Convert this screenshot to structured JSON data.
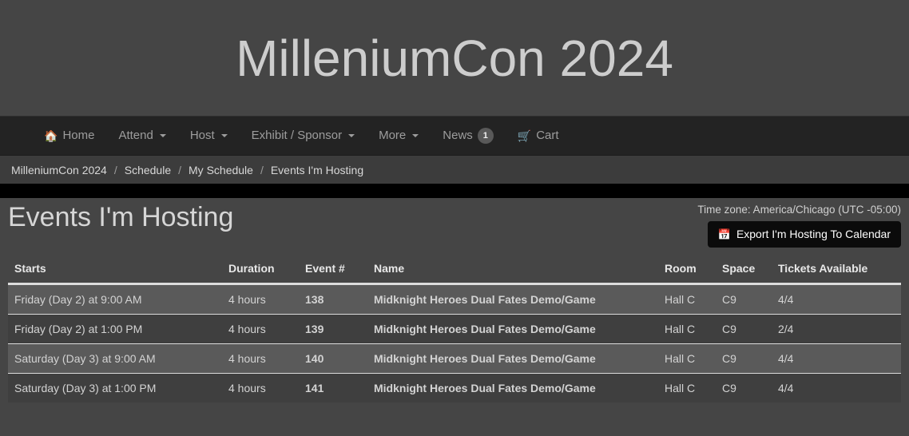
{
  "site": {
    "title": "MilleniumCon 2024"
  },
  "nav": {
    "items": [
      {
        "label": "Home",
        "icon": "home-icon",
        "caret": false,
        "badge": null
      },
      {
        "label": "Attend",
        "icon": null,
        "caret": true,
        "badge": null
      },
      {
        "label": "Host",
        "icon": null,
        "caret": true,
        "badge": null
      },
      {
        "label": "Exhibit / Sponsor",
        "icon": null,
        "caret": true,
        "badge": null
      },
      {
        "label": "More",
        "icon": null,
        "caret": true,
        "badge": null
      },
      {
        "label": "News",
        "icon": null,
        "caret": false,
        "badge": "1"
      },
      {
        "label": "Cart",
        "icon": "cart-icon",
        "caret": false,
        "badge": null
      }
    ]
  },
  "breadcrumb": {
    "separator": "/",
    "items": [
      {
        "label": "MilleniumCon 2024"
      },
      {
        "label": "Schedule"
      },
      {
        "label": "My Schedule"
      },
      {
        "label": "Events I'm Hosting"
      }
    ]
  },
  "page": {
    "title": "Events I'm Hosting",
    "timezone": "Time zone: America/Chicago (UTC -05:00)",
    "export_button": "Export I'm Hosting To Calendar",
    "export_icon": "calendar-icon"
  },
  "table": {
    "columns": [
      "Starts",
      "Duration",
      "Event #",
      "Name",
      "Room",
      "Space",
      "Tickets Available"
    ],
    "rows": [
      {
        "starts": "Friday (Day 2) at 9:00 AM",
        "duration": "4 hours",
        "event": "138",
        "name": "Midknight Heroes Dual Fates Demo/Game",
        "room": "Hall C",
        "space": "C9",
        "tickets": "4/4"
      },
      {
        "starts": "Friday (Day 2) at 1:00 PM",
        "duration": "4 hours",
        "event": "139",
        "name": "Midknight Heroes Dual Fates Demo/Game",
        "room": "Hall C",
        "space": "C9",
        "tickets": "2/4"
      },
      {
        "starts": "Saturday (Day 3) at 9:00 AM",
        "duration": "4 hours",
        "event": "140",
        "name": "Midknight Heroes Dual Fates Demo/Game",
        "room": "Hall C",
        "space": "C9",
        "tickets": "4/4"
      },
      {
        "starts": "Saturday (Day 3) at 1:00 PM",
        "duration": "4 hours",
        "event": "141",
        "name": "Midknight Heroes Dual Fates Demo/Game",
        "room": "Hall C",
        "space": "C9",
        "tickets": "4/4"
      }
    ]
  },
  "colors": {
    "page_background": "#454545",
    "navbar_background": "#232323",
    "breadcrumb_background": "#3c3c3c",
    "strip": "#000000",
    "row_odd": "#5a5a5a",
    "row_even": "#3f3f3f",
    "button_background": "#0b0b0b",
    "text_primary": "#d6d6d6"
  }
}
